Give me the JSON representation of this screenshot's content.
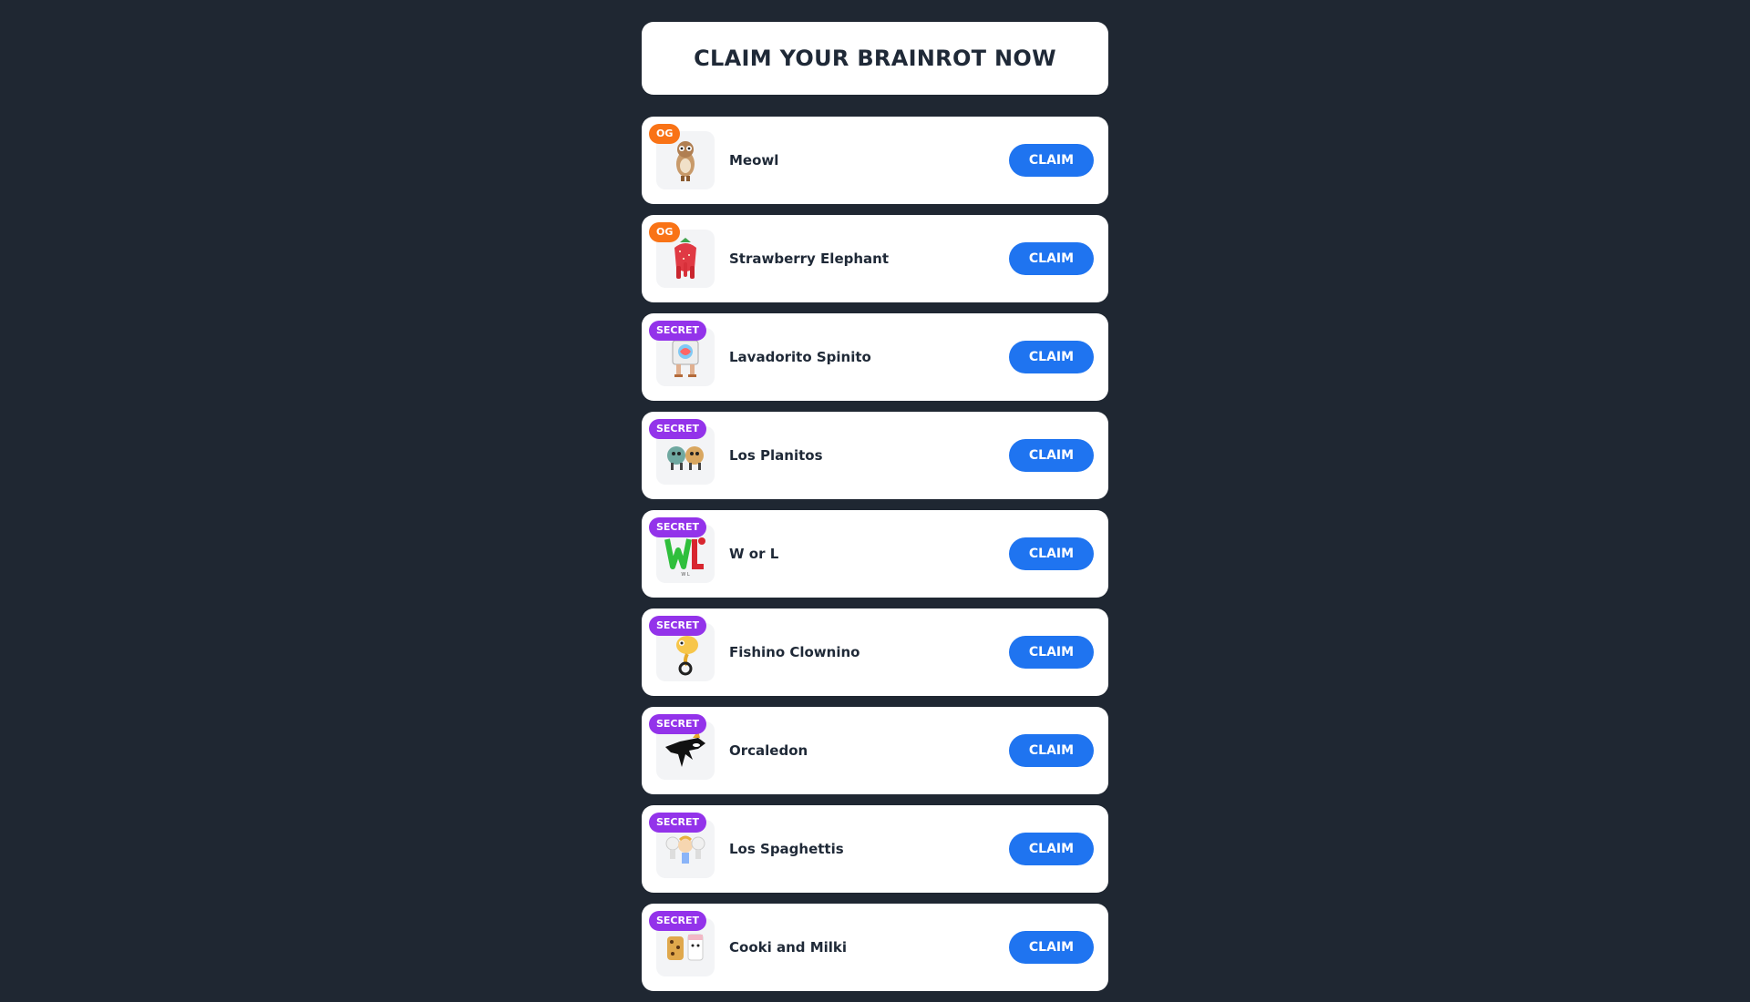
{
  "header": {
    "title": "CLAIM YOUR BRAINROT NOW"
  },
  "items": [
    {
      "name": "Meowl",
      "badge": "OG",
      "badge_type": "og",
      "icon": "meowl-icon"
    },
    {
      "name": "Strawberry Elephant",
      "badge": "OG",
      "badge_type": "og",
      "icon": "strawberry-elephant-icon"
    },
    {
      "name": "Lavadorito Spinito",
      "badge": "SECRET",
      "badge_type": "secret",
      "icon": "lavadorito-spinito-icon"
    },
    {
      "name": "Los Planitos",
      "badge": "SECRET",
      "badge_type": "secret",
      "icon": "los-planitos-icon"
    },
    {
      "name": "W or L",
      "badge": "SECRET",
      "badge_type": "secret",
      "icon": "w-or-l-icon"
    },
    {
      "name": "Fishino Clownino",
      "badge": "SECRET",
      "badge_type": "secret",
      "icon": "fishino-clownino-icon"
    },
    {
      "name": "Orcaledon",
      "badge": "SECRET",
      "badge_type": "secret",
      "icon": "orcaledon-icon"
    },
    {
      "name": "Los Spaghettis",
      "badge": "SECRET",
      "badge_type": "secret",
      "icon": "los-spaghettis-icon"
    },
    {
      "name": "Cooki and Milki",
      "badge": "SECRET",
      "badge_type": "secret",
      "icon": "cooki-and-milki-icon"
    }
  ],
  "claim_label": "CLAIM",
  "colors": {
    "background": "#1f2732",
    "card": "#ffffff",
    "claim_button": "#1f74f0",
    "badge_og": "#f97316",
    "badge_secret": "#9333ea"
  }
}
